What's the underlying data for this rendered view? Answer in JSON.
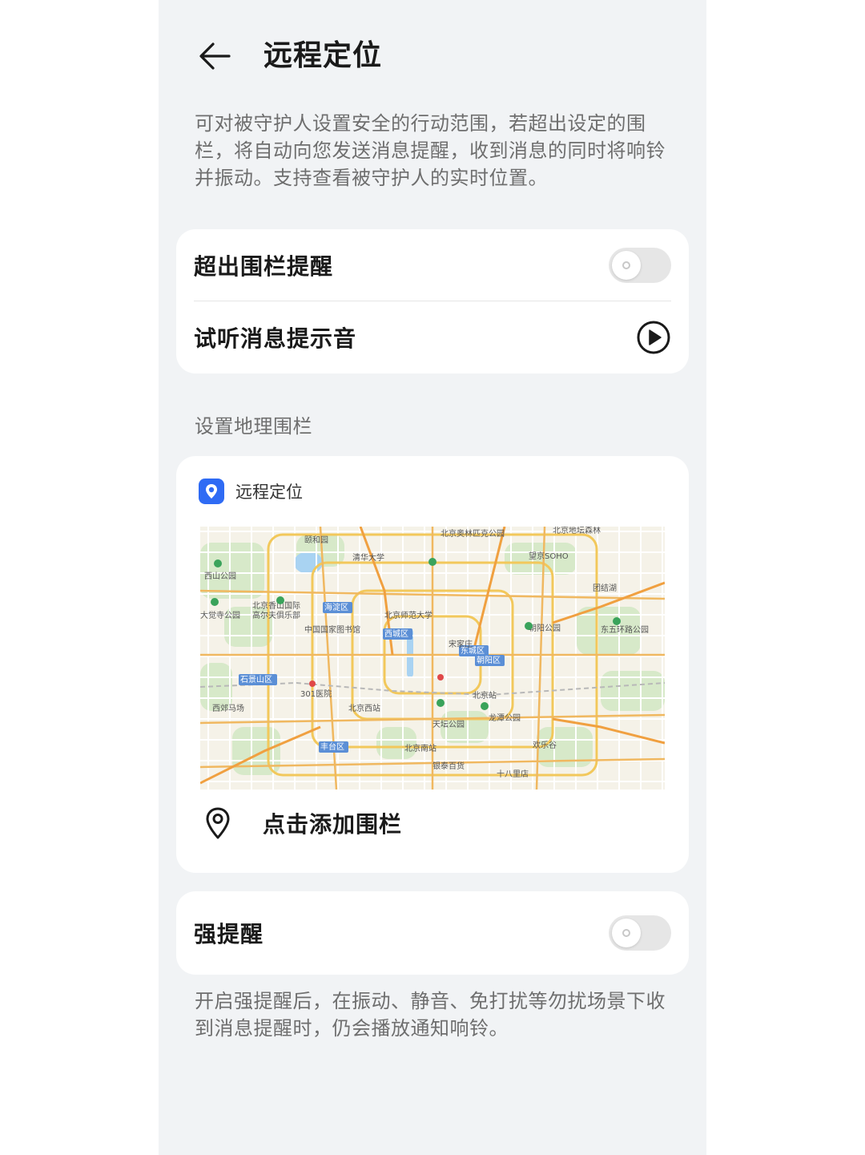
{
  "header": {
    "title": "远程定位"
  },
  "description": "可对被守护人设置安全的行动范围，若超出设定的围栏，将自动向您发送消息提醒，收到消息的同时将响铃并振动。支持查看被守护人的实时位置。",
  "settings": {
    "fence_alert_label": "超出围栏提醒",
    "fence_alert_on": false,
    "preview_sound_label": "试听消息提示音"
  },
  "geofence": {
    "section_title": "设置地理围栏",
    "card_app_name": "远程定位",
    "add_fence_label": "点击添加围栏",
    "map_labels": [
      "颐和园",
      "清华大学",
      "北京奥林匹克公园",
      "北京地坛森林",
      "望京SOHO",
      "西山公园",
      "北京香山国际",
      "高尔夫俱乐部",
      "海淀区",
      "北京师范大学",
      "中国国家图书馆",
      "西城区",
      "东城区",
      "朝阳区",
      "朝阳公园",
      "东五环路公园",
      "石景山区",
      "西郊马场",
      "北京站",
      "301医院",
      "丰台区",
      "北京西站",
      "天坛公园",
      "龙潭公园",
      "北京南站",
      "欢乐谷",
      "银泰百货",
      "十八里店",
      "宋家庄",
      "大觉寺公园",
      "团结湖"
    ]
  },
  "strong_alert": {
    "label": "强提醒",
    "on": false,
    "note": "开启强提醒后，在振动、静音、免打扰等勿扰场景下收到消息提醒时，仍会播放通知响铃。"
  },
  "colors": {
    "page_bg": "#f1f3f5",
    "card_bg": "#ffffff",
    "accent_blue": "#2f6bf4",
    "toggle_off": "#e6e6e6",
    "title_text": "#1a1a1a",
    "secondary_text": "#6e6e6e"
  },
  "icons": {
    "back": "arrow-left-icon",
    "play": "play-circle-icon",
    "app": "location-pin-icon",
    "add": "map-pin-outline-icon"
  }
}
